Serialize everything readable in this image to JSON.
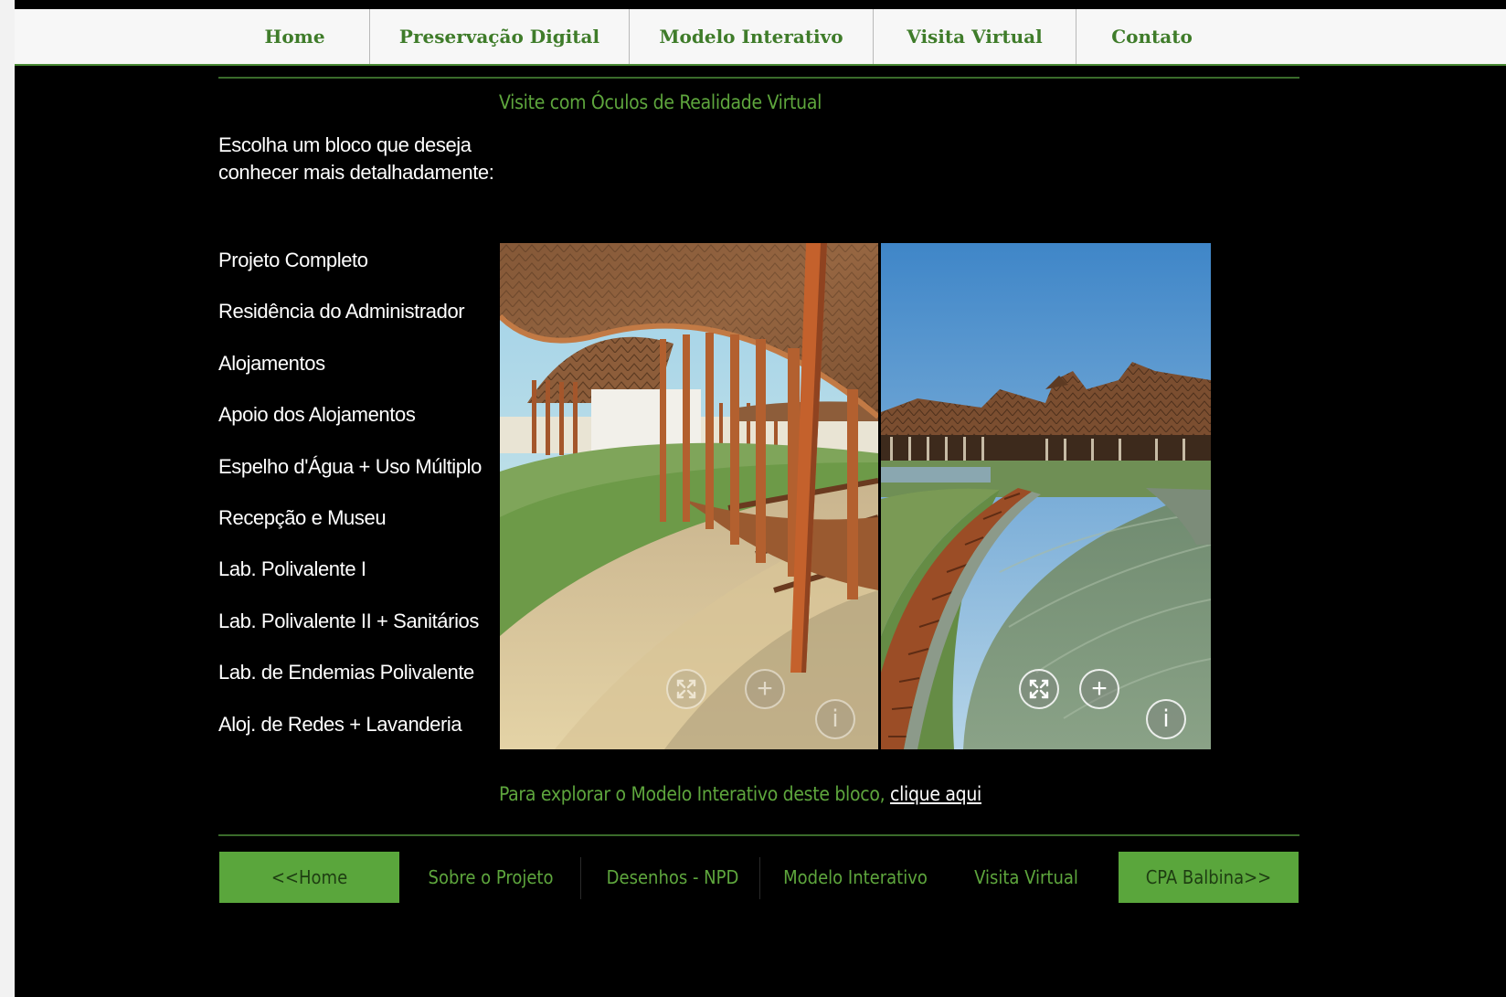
{
  "topnav": {
    "items": [
      {
        "label": "Home"
      },
      {
        "label": "Preservação Digital"
      },
      {
        "label": "Modelo Interativo"
      },
      {
        "label": "Visita Virtual"
      },
      {
        "label": "Contato"
      }
    ]
  },
  "main": {
    "subtitle": "Visite com Óculos de Realidade Virtual",
    "intro": "Escolha um bloco que deseja conhecer mais detalhadamente:",
    "blocks": [
      "Projeto Completo",
      "Residência do Administrador",
      "Alojamentos",
      "Apoio dos Alojamentos",
      "Espelho d'Água + Uso Múltiplo",
      "Recepção e Museu",
      "Lab. Polivalente I",
      "Lab. Polivalente II + Sanitários",
      "Lab. de Endemias Polivalente",
      "Aloj. de Redes + Lavanderia"
    ],
    "viewer_controls": {
      "plus": "+",
      "info": "i"
    },
    "explore_text": "Para explorar o Modelo Interativo deste bloco, ",
    "explore_link": "clique aqui"
  },
  "footer_nav": {
    "home_button": "<<Home",
    "links": [
      "Sobre o Projeto",
      "Desenhos - NPD",
      "Modelo Interativo",
      "Visita Virtual"
    ],
    "next_button": "CPA Balbina>>"
  },
  "colors": {
    "accent_green": "#5ea63d",
    "nav_green": "#3f7c2a",
    "button_green": "#5aa63c",
    "background": "#000000"
  },
  "icons": [
    "fullscreen-icon",
    "zoom-in-icon",
    "info-icon"
  ]
}
